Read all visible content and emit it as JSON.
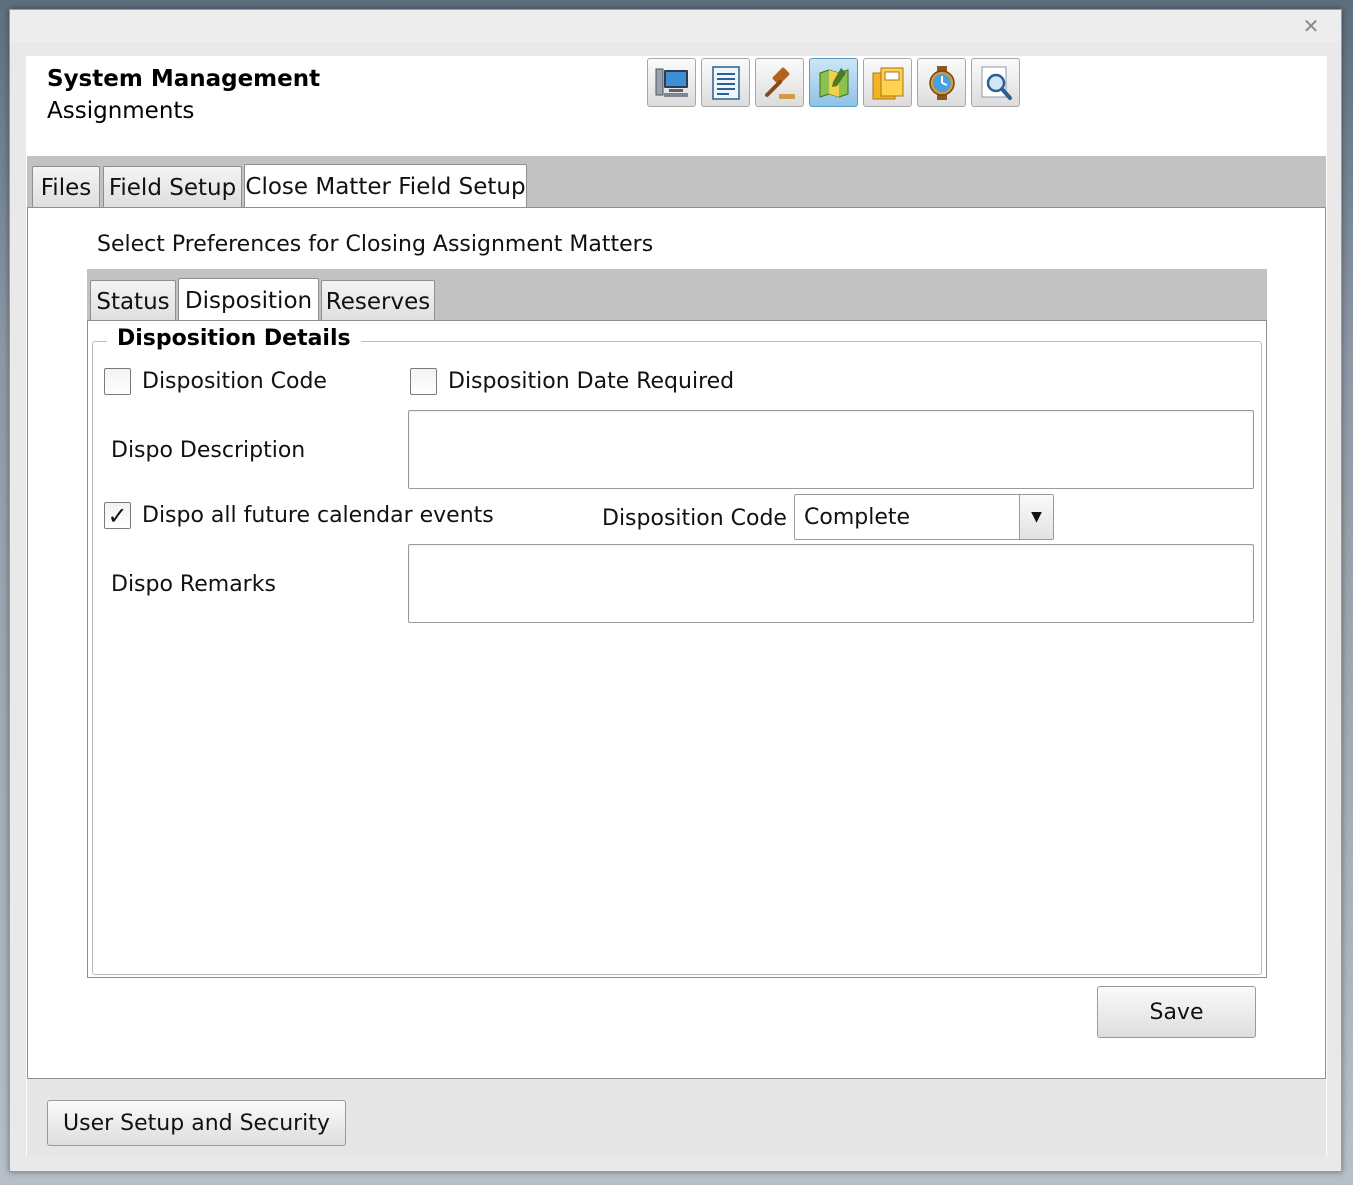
{
  "window": {
    "close_glyph": "✕"
  },
  "header": {
    "title": "System Management",
    "subtitle": "Assignments",
    "toolbar": [
      {
        "icon": "computer-icon"
      },
      {
        "icon": "document-icon"
      },
      {
        "icon": "gavel-icon"
      },
      {
        "icon": "map-icon",
        "active": true
      },
      {
        "icon": "folders-icon"
      },
      {
        "icon": "stopwatch-icon"
      },
      {
        "icon": "search-document-icon"
      }
    ]
  },
  "outer_tabs": [
    {
      "label": "Files"
    },
    {
      "label": "Field Setup"
    },
    {
      "label": "Close Matter Field Setup",
      "selected": true
    }
  ],
  "panel": {
    "heading": "Select Preferences for Closing Assignment Matters",
    "inner_tabs": [
      {
        "label": "Status"
      },
      {
        "label": "Disposition",
        "selected": true
      },
      {
        "label": "Reserves"
      }
    ],
    "group_title": "Disposition Details",
    "disposition_code_cb": {
      "label": "Disposition Code",
      "checked": false
    },
    "disposition_date_cb": {
      "label": "Disposition Date Required",
      "checked": false
    },
    "dispo_description": {
      "label": "Dispo Description",
      "value": ""
    },
    "dispo_future_cb": {
      "label": "Dispo all future calendar events",
      "checked": true
    },
    "disposition_code_select": {
      "label": "Disposition Code",
      "value": "Complete"
    },
    "dispo_remarks": {
      "label": "Dispo Remarks",
      "value": ""
    },
    "save_label": "Save"
  },
  "footer": {
    "user_setup_label": "User Setup and Security"
  },
  "colors": {
    "active_tool": "#8fc3e3",
    "tab_strip": "#c2c2c2"
  }
}
